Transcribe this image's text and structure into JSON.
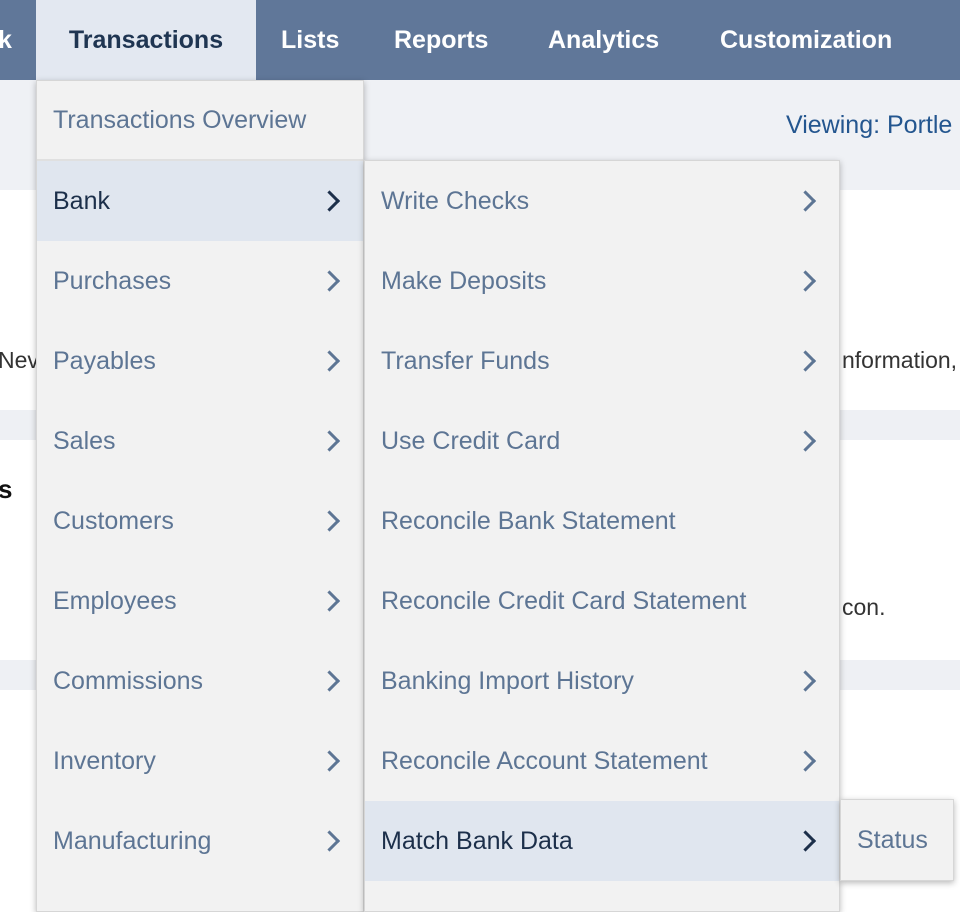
{
  "topnav": {
    "cut_label": "k",
    "items": [
      {
        "label": "Transactions"
      },
      {
        "label": "Lists"
      },
      {
        "label": "Reports"
      },
      {
        "label": "Analytics"
      },
      {
        "label": "Customization"
      }
    ]
  },
  "subbar": {
    "viewing": "Viewing: Portle"
  },
  "background": {
    "left_fragment_1": "Nev",
    "right_fragment_1": "nformation,",
    "left_fragment_2": "s",
    "right_fragment_2": "con."
  },
  "menu_level1": {
    "overview": "Transactions Overview",
    "items": [
      {
        "label": "Bank"
      },
      {
        "label": "Purchases"
      },
      {
        "label": "Payables"
      },
      {
        "label": "Sales"
      },
      {
        "label": "Customers"
      },
      {
        "label": "Employees"
      },
      {
        "label": "Commissions"
      },
      {
        "label": "Inventory"
      },
      {
        "label": "Manufacturing"
      }
    ]
  },
  "menu_level2": {
    "items": [
      {
        "label": "Write Checks"
      },
      {
        "label": "Make Deposits"
      },
      {
        "label": "Transfer Funds"
      },
      {
        "label": "Use Credit Card"
      },
      {
        "label": "Reconcile Bank Statement"
      },
      {
        "label": "Reconcile Credit Card Statement"
      },
      {
        "label": "Banking Import History"
      },
      {
        "label": "Reconcile Account Statement"
      },
      {
        "label": "Match Bank Data"
      }
    ]
  },
  "menu_level3": {
    "items": [
      {
        "label": "Status"
      }
    ]
  },
  "colors": {
    "nav_bg": "#607799",
    "nav_active_bg": "#e3e8f1",
    "menu_bg": "#f2f2f2",
    "menu_highlight": "#e0e6ef",
    "menu_text": "#5d7594",
    "link_blue": "#24568f"
  },
  "icons": {
    "submenu_arrow": "chevron-right-icon"
  }
}
